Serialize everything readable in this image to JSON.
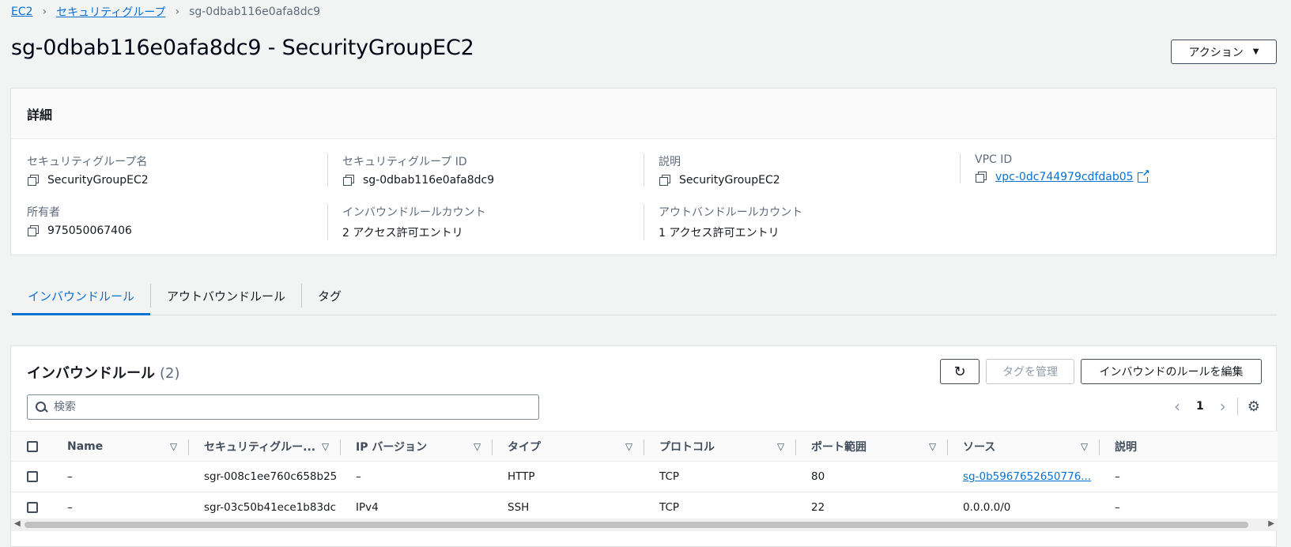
{
  "breadcrumb": {
    "items": [
      "EC2",
      "セキュリティグループ"
    ],
    "current": "sg-0dbab116e0afa8dc9"
  },
  "page_title": "sg-0dbab116e0afa8dc9 - SecurityGroupEC2",
  "actions_button": "アクション",
  "details": {
    "header": "詳細",
    "fields": [
      {
        "label": "セキュリティグループ名",
        "value": "SecurityGroupEC2",
        "icon": "copy-icon"
      },
      {
        "label": "セキュリティグループ ID",
        "value": "sg-0dbab116e0afa8dc9",
        "icon": "copy-icon"
      },
      {
        "label": "説明",
        "value": "SecurityGroupEC2",
        "icon": "copy-icon"
      },
      {
        "label": "VPC ID",
        "value": "vpc-0dc744979cdfdab05",
        "icon": "copy-icon",
        "link": true
      },
      {
        "label": "所有者",
        "value": "975050067406",
        "icon": "copy-icon"
      },
      {
        "label": "インバウンドルールカウント",
        "value": "2 アクセス許可エントリ"
      },
      {
        "label": "アウトバンドルールカウント",
        "value": "1 アクセス許可エントリ"
      }
    ]
  },
  "tabs": [
    {
      "label": "インバウンドルール",
      "active": true
    },
    {
      "label": "アウトバウンドルール",
      "active": false
    },
    {
      "label": "タグ",
      "active": false
    }
  ],
  "rules": {
    "title": "インバウンドルール",
    "count": "(2)",
    "manage_tags_button": "タグを管理",
    "edit_button": "インバウンドのルールを編集",
    "search_placeholder": "検索",
    "page": "1",
    "columns": [
      "Name",
      "セキュリティグルー...",
      "IP バージョン",
      "タイプ",
      "プロトコル",
      "ポート範囲",
      "ソース",
      "説明"
    ],
    "rows": [
      [
        "–",
        "sgr-008c1ee760c658b25",
        "–",
        "HTTP",
        "TCP",
        "80",
        "sg-0b5967652650776...",
        "–"
      ],
      [
        "–",
        "sgr-03c50b41ece1b83dc",
        "IPv4",
        "SSH",
        "TCP",
        "22",
        "0.0.0.0/0",
        "–"
      ]
    ]
  },
  "colors": {
    "link": "#0972d3",
    "background": "#f2f3f3",
    "text": "#16191f"
  }
}
